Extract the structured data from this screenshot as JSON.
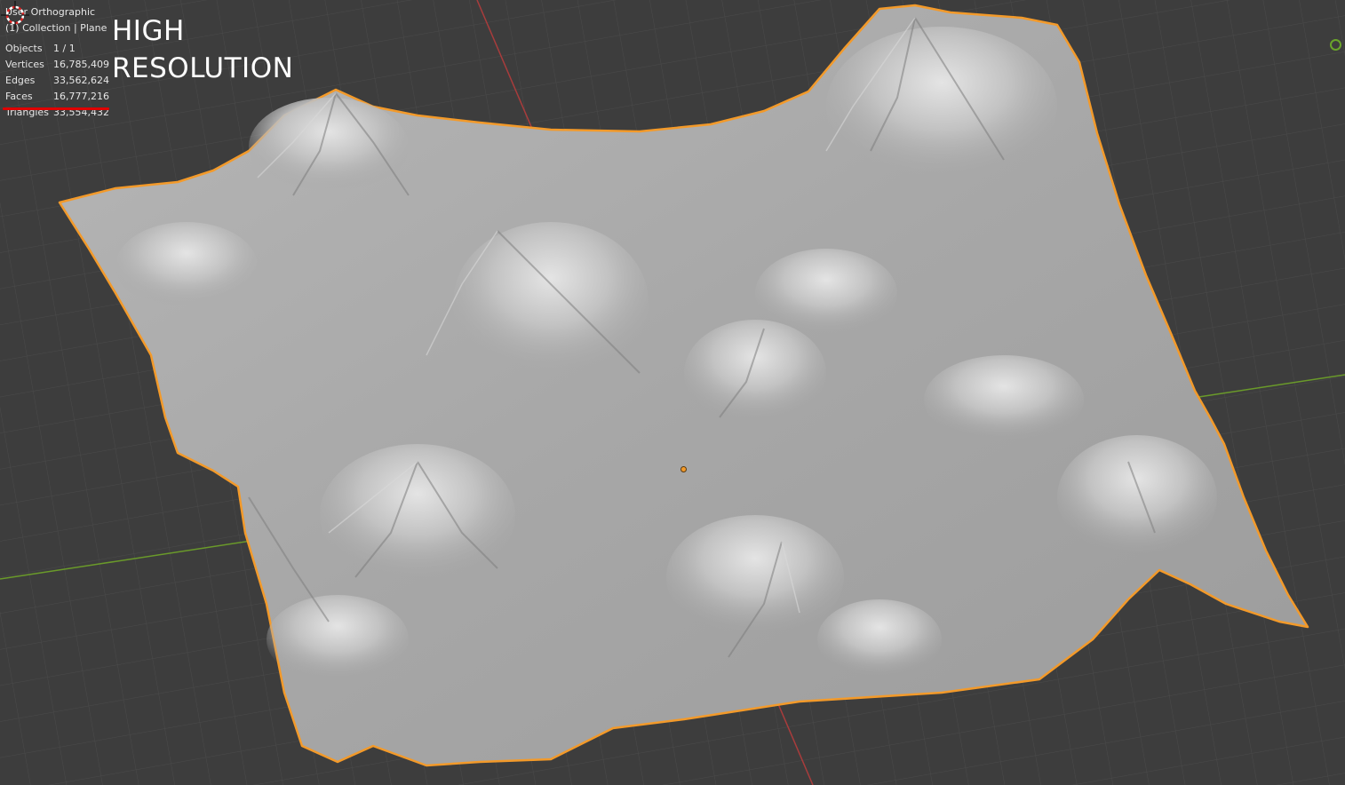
{
  "viewport": {
    "view_name": "User Orthographic",
    "collection_path": "(1) Collection | Plane",
    "overlay_title_line1": "HIGH",
    "overlay_title_line2": "RESOLUTION"
  },
  "statistics": [
    {
      "label": "Objects",
      "value": "1 / 1"
    },
    {
      "label": "Vertices",
      "value": "16,785,409"
    },
    {
      "label": "Edges",
      "value": "33,562,624"
    },
    {
      "label": "Faces",
      "value": "16,777,216"
    },
    {
      "label": "Triangles",
      "value": "33,554,432"
    }
  ],
  "colors": {
    "background": "#3d3d3d",
    "grid": "#4a4a4a",
    "x_axis": "#a83c3c",
    "y_axis": "#6a9a2a",
    "selection_outline": "#f39a2a",
    "terrain": "#a9a9a9",
    "highlight": "#e00000"
  },
  "icons": {
    "cursor": "3d-cursor-icon",
    "origin": "object-origin-icon",
    "gizmo": "navigation-gizmo-icon"
  }
}
